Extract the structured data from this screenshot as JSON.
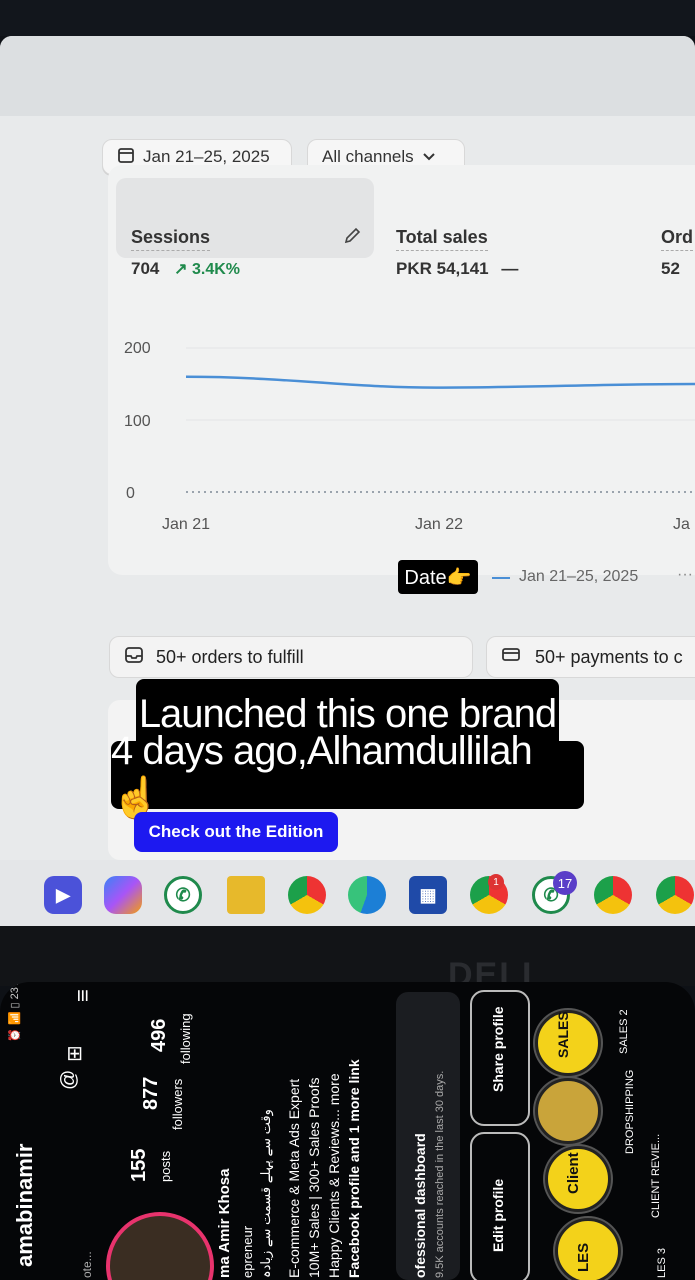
{
  "dashboard": {
    "date_filter": "Jan 21–25, 2025",
    "channel_filter": "All channels",
    "metrics": [
      {
        "label": "Sessions",
        "value": "704",
        "trend": "3.4K%"
      },
      {
        "label": "Total sales",
        "value": "PKR 54,141",
        "trend": "—"
      },
      {
        "label": "Ord",
        "value": "52"
      }
    ],
    "legend_label": "Jan 21–25, 2025",
    "legend_more": "···",
    "orders_banner": "50+ orders to fulfill",
    "payments_banner": "50+ payments to c",
    "cta_label": "Check out the Edition"
  },
  "chart_data": {
    "type": "line",
    "x": [
      "Jan 21",
      "Jan 22",
      "Ja"
    ],
    "series": [
      {
        "values": [
          160,
          145,
          150
        ]
      },
      {
        "values": [
          0,
          0,
          0
        ]
      }
    ],
    "yticks": [
      "200",
      "100",
      "0"
    ],
    "ylim": [
      0,
      200
    ],
    "grid": true,
    "colors": [
      "#4a8fd6",
      "#9aa3ad"
    ]
  },
  "overlay": {
    "date_sticker": "Date👉",
    "caption_line1": "Launched this one brand",
    "caption_line2": "4 days ago,Alhamdullilah ☝️"
  },
  "taskbar": {
    "whatsapp_badge": "17",
    "chrome_badge": "1"
  },
  "monitor_brand": "DELL",
  "instagram": {
    "status": "23%",
    "username": "amabinamir",
    "posts_count": "155",
    "posts_label": "posts",
    "followers_count": "877",
    "followers_label": "followers",
    "following_count": "496",
    "following_label": "following",
    "bio_name": "ma Amir Khosa",
    "bio_role": "epreneur",
    "bio_urdu": "وقت سے پہلے قسمت سے زیادہ",
    "bio_line1": "E-commerce & Meta Ads Expert",
    "bio_line2": "10M+ Sales | 300+ Sales Proofs",
    "bio_line3": "Happy Clients & Reviews... more",
    "bio_line4": "Facebook profile and 1 more link",
    "dash_title": "ofessional dashboard",
    "dash_sub": "9.5K accounts reached in the last 30 days.",
    "edit_profile": "Edit profile",
    "share_profile": "Share profile",
    "highlights": [
      "SALES 2",
      "DROPSHIPPING",
      "CLIENT REVIE...",
      "LES 3"
    ],
    "highlight_badges": [
      "SALES",
      "Client",
      "LES"
    ],
    "bottom_label": "ote..."
  }
}
